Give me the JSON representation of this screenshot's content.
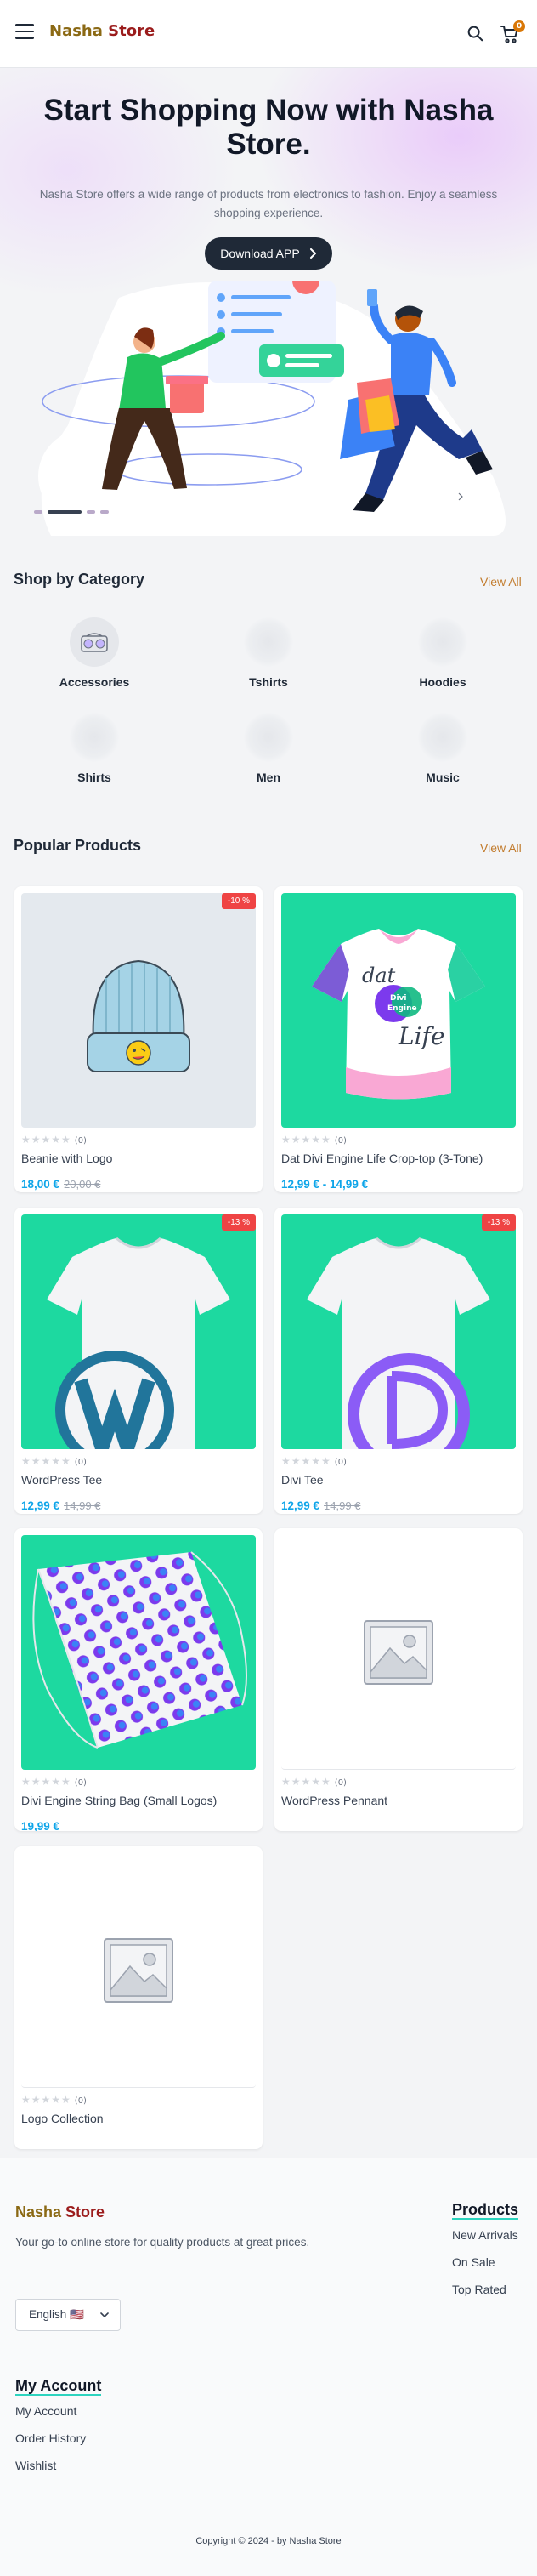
{
  "header": {
    "brand_first": "Nasha",
    "brand_second": " Store",
    "cart_count": "0",
    "icons": {
      "menu": "hamburger-icon",
      "search": "search-icon",
      "cart": "cart-icon"
    }
  },
  "hero": {
    "title": "Start Shopping Now with Nasha Store.",
    "description": "Nasha Store offers a wide range of products from electronics to fashion. Enjoy a seamless shopping experience.",
    "button_label": "Download APP",
    "slide_count": 4,
    "active_slide": 1
  },
  "categories": {
    "title": "Shop by Category",
    "view_all": "View All",
    "items": [
      {
        "label": "Accessories"
      },
      {
        "label": "Tshirts"
      },
      {
        "label": "Hoodies"
      },
      {
        "label": "Shirts"
      },
      {
        "label": "Men"
      },
      {
        "label": "Music"
      }
    ]
  },
  "products": {
    "title": "Popular Products",
    "view_all": "View All",
    "items": [
      {
        "name": "Beanie with Logo",
        "price": "18,00 €",
        "old_price": "20,00 €",
        "badge": "-10 %",
        "rating_count": "(0)"
      },
      {
        "name": "Dat Divi Engine Life Crop-top (3-Tone)",
        "price": "12,99 € - 14,99 €",
        "old_price": "",
        "badge": "",
        "rating_count": "(0)"
      },
      {
        "name": "WordPress Tee",
        "price": "12,99 €",
        "old_price": "14,99 €",
        "badge": "-13 %",
        "rating_count": "(0)"
      },
      {
        "name": "Divi Tee",
        "price": "12,99 €",
        "old_price": "14,99 €",
        "badge": "-13 %",
        "rating_count": "(0)"
      },
      {
        "name": "Divi Engine String Bag (Small Logos)",
        "price": "19,99 €",
        "old_price": "",
        "badge": "",
        "rating_count": "(0)"
      },
      {
        "name": "WordPress Pennant",
        "price": "",
        "old_price": "",
        "badge": "",
        "rating_count": "(0)"
      },
      {
        "name": "Logo Collection",
        "price": "",
        "old_price": "",
        "badge": "",
        "rating_count": "(0)"
      }
    ],
    "crop_top_text": {
      "line1": "dat",
      "line2": "Divi",
      "line3": "Engine",
      "line4": "Life"
    }
  },
  "footer": {
    "brand_first": "Nasha",
    "brand_second": " Store",
    "description": "Your go-to online store for quality products at great prices.",
    "language": "English 🇺🇸",
    "products_heading": "Products",
    "products_links": [
      "New Arrivals",
      "On Sale",
      "Top Rated"
    ],
    "account_heading": "My Account",
    "account_links": [
      "My Account",
      "Order History",
      "Wishlist"
    ],
    "copyright": "Copyright © 2024 - by Nasha Store"
  },
  "colors": {
    "brand_gold": "#8b6914",
    "brand_red": "#9b1c1c",
    "accent_orange": "#c27c2e",
    "price_blue": "#0ea5e9",
    "sale_red": "#ef4444",
    "product_bg_green": "#1dd9a0",
    "button_dark": "#1f2937"
  }
}
